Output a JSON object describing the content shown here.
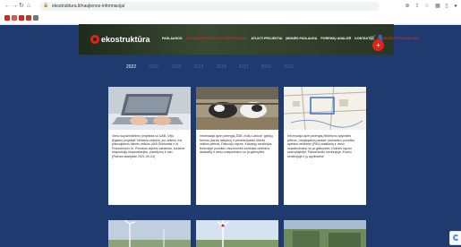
{
  "browser": {
    "url": "ekostruktura.lt/naujienos-informacija/",
    "nav": [
      "←",
      "→",
      "C",
      "⌂"
    ]
  },
  "site": {
    "logo": "ekostruktūra",
    "menu": [
      {
        "label": "PASLAUGOS",
        "active": false
      },
      {
        "label": "AKTUALŪS PROJEKTAI / INFORMACIJA",
        "active": true
      },
      {
        "label": "ATLIKTI PROJEKTAI",
        "active": false
      },
      {
        "label": "ĮMONĖS PASLAUGA",
        "active": false
      },
      {
        "label": "POREIKIŲ ANALIZĖ",
        "active": false
      },
      {
        "label": "KONTAKTAI",
        "active": false
      },
      {
        "label": "ATSISIŲSKITE PASIŪLYMĄ",
        "active": true
      }
    ],
    "fab_icon": "+"
  },
  "years": [
    {
      "label": "2022",
      "active": true
    },
    {
      "label": "2021",
      "active": false
    },
    {
      "label": "2020",
      "active": false
    },
    {
      "label": "2019",
      "active": false
    },
    {
      "label": "2018",
      "active": false
    },
    {
      "label": "2017",
      "active": false
    },
    {
      "label": "2016",
      "active": false
    },
    {
      "label": "2015",
      "active": false
    }
  ],
  "cards": [
    {
      "text": "Viešo supažindinimo projektas su UAB „Vėjo jėgainių projektai“ teikiamu objektu, jos veiklos Jos planuojamos ūkinės veiklos UAB Skirtumas ir kt. Pranešimai ir kt. Pirmasis objekto variantas, kuriame ekspozicijų eksploatacijos, pasiūlymų ir pan. (Plačiau skaitykite 2021-09-24)"
    },
    {
      "text": "Informacija apie parengtą ŽŪB „Kūlių Lankos“ galvijų fermos (karvių laikymo) ir pienininkystės ūkinės veiklos plėtros, Pakruojo rajone, Kalvarijų seniūnijos teritorijoje poveikio visuomenės sveikatai vertinimo ataskaitą ir viešo susipažinimo su ja galimybes"
    },
    {
      "text": "Informacija apie parengtą Medelyno apylinkės plėtros „Vėjojėgainių parkas“ planavimo poveikio aplinkai vertinimo (PAV) ataskaitą ir viešo supažindinimo su ja galimybes, Kelmės rajono savivaldybėje, Pakražančio seniūnijoje, Kražių seniūnijoje ir jų apylinkėse"
    }
  ],
  "colors": {
    "page_bg": "#1e3a6e",
    "accent": "#e2231a",
    "header_bg": "#2a3526"
  }
}
